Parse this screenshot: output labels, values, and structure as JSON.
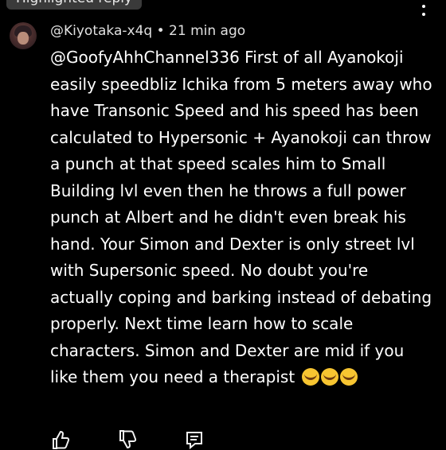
{
  "header": {
    "label": "Highlighted reply"
  },
  "comment": {
    "author": "@Kiyotaka-x4q",
    "separator": "•",
    "time": "21 min ago",
    "text": "@GoofyAhhChannel336  First of all Ayanokoji easily speedbliz Ichika from 5 meters away who have Transonic Speed and his speed has been calculated to Hypersonic + Ayanokoji can throw a punch at that speed scales him to Small Building lvl even then he throws a full power punch at Albert and he didn't even break his hand. Your Simon and Dexter is only street lvl with Supersonic speed. No doubt you're actually coping and barking instead of debating properly. Next time learn how to scale characters. Simon and Dexter are mid if you like them you need a therapist",
    "emoji_count": 3,
    "emoji": "😂"
  },
  "icons": {
    "menu": "more-vertical-icon",
    "like": "thumbs-up-icon",
    "dislike": "thumbs-down-icon",
    "reply": "comment-icon"
  }
}
